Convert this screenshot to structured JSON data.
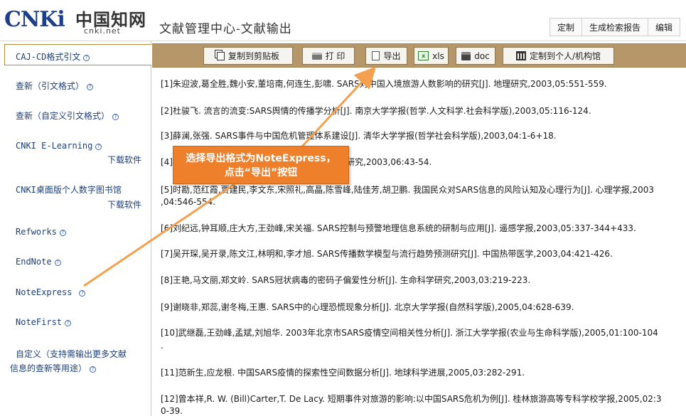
{
  "header": {
    "logo_text": "CNKi",
    "logo_cn": "中国知网",
    "logo_url": "cnki.net",
    "title": "文献管理中心-文献输出",
    "links": [
      "定制",
      "生成检索报告",
      "编辑"
    ]
  },
  "sidebar": {
    "items": [
      {
        "label": "CAJ-CD格式引文",
        "download": ""
      },
      {
        "label": "查新（引文格式）",
        "download": ""
      },
      {
        "label": "查新（自定义引文格式）",
        "download": ""
      },
      {
        "label": "CNKI E-Learning",
        "download": "下载软件"
      },
      {
        "label": "CNKI桌面版个人数字图书馆",
        "download": "下载软件"
      },
      {
        "label": "Refworks",
        "download": ""
      },
      {
        "label": "EndNote",
        "download": ""
      },
      {
        "label": "NoteExpress",
        "download": ""
      },
      {
        "label": "NoteFirst",
        "download": ""
      },
      {
        "label": "自定义（支持需输出更多文献",
        "label2": "信息的查新等用途）",
        "download": ""
      }
    ]
  },
  "toolbar": {
    "copy": "复制到剪贴板",
    "print": "打 印",
    "export": "导出",
    "xls": "xls",
    "doc": "doc",
    "library": "定制到个人/机构馆",
    "icons": [
      "copy-icon",
      "print-icon",
      "export-icon",
      "xls-icon",
      "doc-icon",
      "library-icon"
    ]
  },
  "references": [
    "[1]朱迎波,葛全胜,魏小安,董培南,何连生,彭啸. SARS对中国入境旅游人数影响的研究[J]. 地理研究,2003,05:551-559.",
    "[2]杜骏飞. 流言的流变:SARS舆情的传播学分析[J]. 南京大学学报(哲学.人文科学.社会科学版),2003,05:116-124.",
    "[3]薛澜,张强. SARS事件与中国危机管理体系建设[J]. 清华大学学报(哲学社会科学版),2003,04:1-6+18.",
    "[4]周晓虹. 传媒时代的社会心理学分析[J]. 社会学研究,2003,06:43-54.",
    "[5]时勘,范红霞,贾建民,李文东,宋照礼,高晶,陈雪峰,陆佳芳,胡卫鹏. 我国民众对SARS信息的风险认知及心理行为[J]. 心理学报,2003",
    ",04:546-554.",
    "[6]刘纪远,钟耳顺,庄大方,王劲峰,宋关福. SARS控制与预警地理信息系统的研制与应用[J]. 遥感学报,2003,05:337-344+433.",
    "[7]吴开琛,吴开录,陈文江,林明和,李才旭. SARS传播数学模型与流行趋势预测研究[J]. 中国热带医学,2003,04:421-426.",
    "[8]王艳,马文丽,郑文岭. SARS冠状病毒的密码子偏爱性分析[J]. 生命科学研究,2003,03:219-223.",
    "[9]谢晓非,郑蕊,谢冬梅,王惠. SARS中的心理恐慌现象分析[J]. 北京大学学报(自然科学版),2005,04:628-639.",
    "[10]武继磊,王劲峰,孟斌,刘旭华. 2003年北京市SARS疫情空间相关性分析[J]. 浙江大学学报(农业与生命科学版),2005,01:100-104",
    ".",
    "[11]范新生,应龙根. 中国SARS疫情的探索性空间数据分析[J]. 地球科学进展,2005,03:282-291.",
    "[12]曾本祥,R. W. (Bill)Carter,T. De Lacy. 短期事件对旅游的影响:以中国SARS危机为例[J]. 桂林旅游高等专科学校学报,2005,02:3",
    "0-39."
  ],
  "callout": {
    "line1": "选择导出格式为NoteExpress，",
    "line2": "点击“导出”按钮"
  },
  "colors": {
    "toolbar_bg": "#b5976a",
    "callout_bg": "#ee7f2b",
    "link_blue": "#1e3f7a"
  }
}
